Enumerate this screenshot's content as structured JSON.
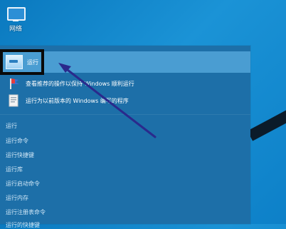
{
  "desktop": {
    "icon_label": "网络"
  },
  "search_panel": {
    "best_match_label": "运行",
    "results": [
      {
        "label": "查看推荐的操作以保持 Windows 顺利运行"
      },
      {
        "label": "运行为以前版本的 Windows 编写的程序"
      }
    ],
    "suggestions": [
      "运行",
      "运行命令",
      "运行快捷键",
      "运行库",
      "运行启动命令",
      "运行内存",
      "运行注册表命令",
      "运行的快捷键"
    ]
  },
  "colors": {
    "panel_bg": "#1d6fa8",
    "selected_bg": "#4a9dd2",
    "arrow": "#2a2a8c",
    "highlight_border": "#0a0a0a"
  }
}
